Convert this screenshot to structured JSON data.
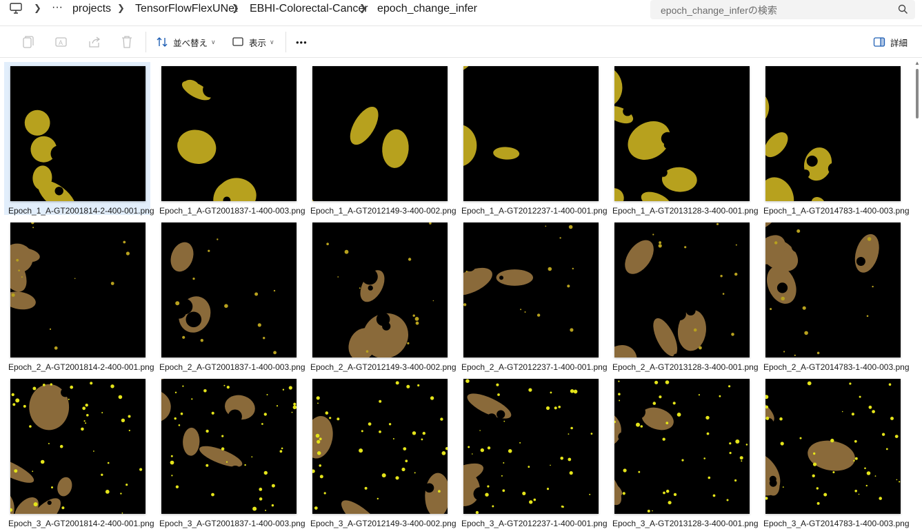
{
  "address": {
    "breadcrumbs": [
      "projects",
      "TensorFlowFlexUNet",
      "EBHI-Colorectal-Cancer",
      "epoch_change_infer"
    ],
    "overflow_label": "···",
    "search_placeholder": "epoch_change_inferの検索"
  },
  "toolbar": {
    "sort_label": "並べ替え",
    "view_label": "表示",
    "more_label": "•••",
    "details_label": "詳細"
  },
  "colors": {
    "mask_yellow": "#b7a11e",
    "mask_brown": "#8a6a3a",
    "bright_yellow": "#e4e41a",
    "selection": "#e2eefb"
  },
  "files": [
    {
      "name": "Epoch_1_A-GT2001814-2-400-001.png",
      "selected": true
    },
    {
      "name": "Epoch_1_A-GT2001837-1-400-003.png"
    },
    {
      "name": "Epoch_1_A-GT2012149-3-400-002.png"
    },
    {
      "name": "Epoch_1_A-GT2012237-1-400-001.png"
    },
    {
      "name": "Epoch_1_A-GT2013128-3-400-001.png"
    },
    {
      "name": "Epoch_1_A-GT2014783-1-400-003.png"
    },
    {
      "name": "Epoch_2_A-GT2001814-2-400-001.png"
    },
    {
      "name": "Epoch_2_A-GT2001837-1-400-003.png"
    },
    {
      "name": "Epoch_2_A-GT2012149-3-400-002.png"
    },
    {
      "name": "Epoch_2_A-GT2012237-1-400-001.png"
    },
    {
      "name": "Epoch_2_A-GT2013128-3-400-001.png"
    },
    {
      "name": "Epoch_2_A-GT2014783-1-400-003.png"
    },
    {
      "name": "Epoch_3_A-GT2001814-2-400-001.png"
    },
    {
      "name": "Epoch_3_A-GT2001837-1-400-003.png"
    },
    {
      "name": "Epoch_3_A-GT2012149-3-400-002.png"
    },
    {
      "name": "Epoch_3_A-GT2012237-1-400-001.png"
    },
    {
      "name": "Epoch_3_A-GT2013128-3-400-001.png"
    },
    {
      "name": "Epoch_3_A-GT2014783-1-400-003.png"
    }
  ]
}
